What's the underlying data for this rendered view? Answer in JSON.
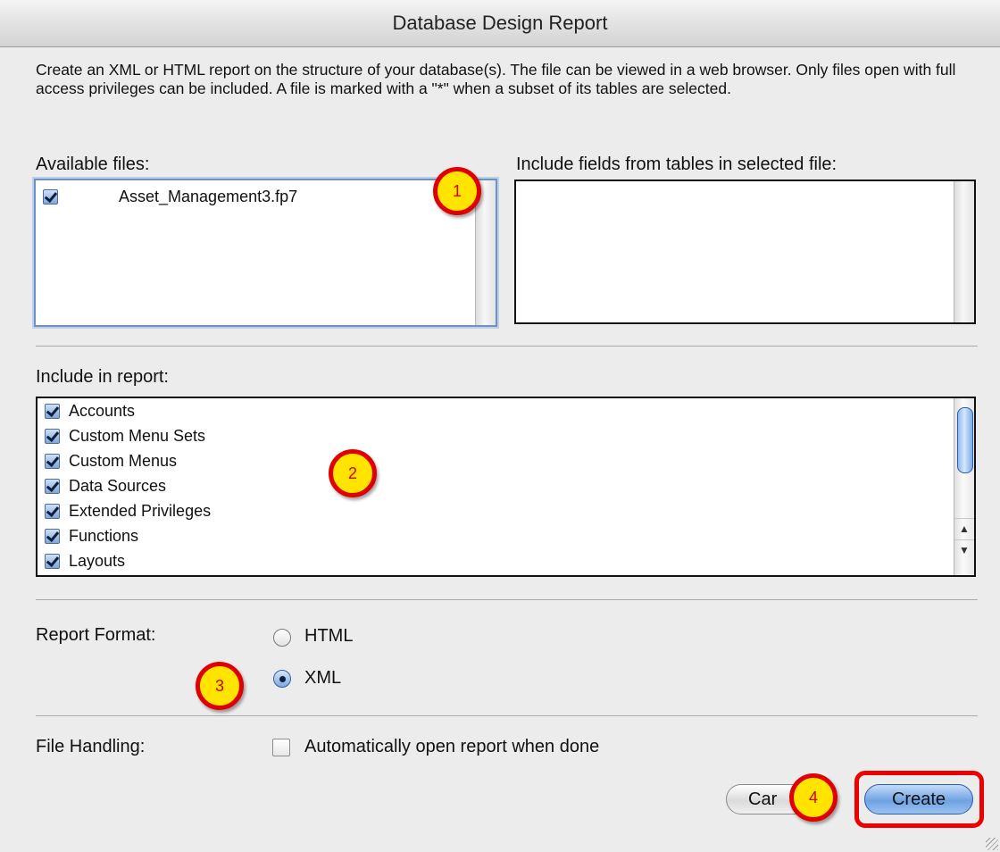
{
  "window": {
    "title": "Database Design Report"
  },
  "description": "Create an XML or HTML report on the structure of your database(s). The file can be viewed in a web browser. Only files open with full access privileges can be included. A file is marked with a \"*\" when a subset of its tables are selected.",
  "available_files": {
    "label": "Available files:",
    "items": [
      {
        "name": "Asset_Management3.fp7",
        "checked": true
      }
    ]
  },
  "tables": {
    "label": "Include fields from tables in selected file:"
  },
  "report": {
    "label": "Include in report:",
    "items": [
      {
        "name": "Accounts",
        "checked": true
      },
      {
        "name": "Custom Menu Sets",
        "checked": true
      },
      {
        "name": "Custom Menus",
        "checked": true
      },
      {
        "name": "Data Sources",
        "checked": true
      },
      {
        "name": "Extended Privileges",
        "checked": true
      },
      {
        "name": "Functions",
        "checked": true
      },
      {
        "name": "Layouts",
        "checked": true
      }
    ]
  },
  "format": {
    "label": "Report Format:",
    "options": [
      {
        "name": "HTML",
        "selected": false
      },
      {
        "name": "XML",
        "selected": true
      }
    ]
  },
  "file_handling": {
    "label": "File Handling:",
    "auto_open_label": "Automatically open report when done",
    "auto_open_checked": false
  },
  "buttons": {
    "cancel": "Cancel",
    "cancel_visible": "Car",
    "create": "Create"
  },
  "callouts": [
    "1",
    "2",
    "3",
    "4"
  ],
  "colors": {
    "callout_fill": "#ffe400",
    "callout_border": "#e00000",
    "accent": "#6ea2e3"
  }
}
